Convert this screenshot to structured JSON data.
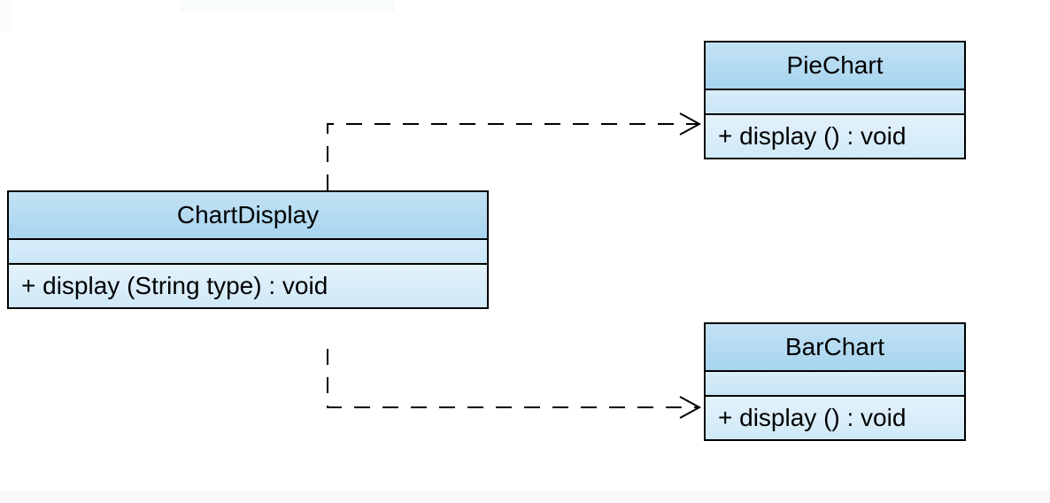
{
  "classes": {
    "chartDisplay": {
      "name": "ChartDisplay",
      "methods": [
        "+  display (String type)  : void"
      ]
    },
    "pieChart": {
      "name": "PieChart",
      "methods": [
        "+  display ()  : void"
      ]
    },
    "barChart": {
      "name": "BarChart",
      "methods": [
        "+  display ()  : void"
      ]
    }
  },
  "relations": [
    {
      "from": "ChartDisplay",
      "to": "PieChart",
      "type": "dependency"
    },
    {
      "from": "ChartDisplay",
      "to": "BarChart",
      "type": "dependency"
    }
  ],
  "colors": {
    "classBorder": "#000000",
    "classFillTop": "#d9ecf9",
    "classFillBottom": "#a7d4ef"
  }
}
